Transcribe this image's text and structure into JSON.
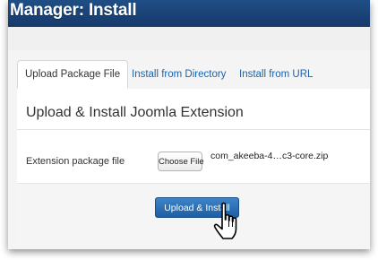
{
  "header": {
    "title": "Manager: Install"
  },
  "tabs": [
    {
      "label": "Upload Package File",
      "active": true
    },
    {
      "label": "Install from Directory",
      "active": false
    },
    {
      "label": "Install from URL",
      "active": false
    }
  ],
  "panel": {
    "heading": "Upload & Install Joomla Extension",
    "field_label": "Extension package file",
    "choose_file_label": "Choose File",
    "selected_file": "com_akeeba-4…c3-core.zip",
    "upload_button": "Upload & Install"
  },
  "colors": {
    "header_bg": "#1f4e86",
    "link": "#1a62ad",
    "primary_button": "#2a6db4"
  },
  "icons": {
    "cursor": "hand-pointer-icon"
  }
}
